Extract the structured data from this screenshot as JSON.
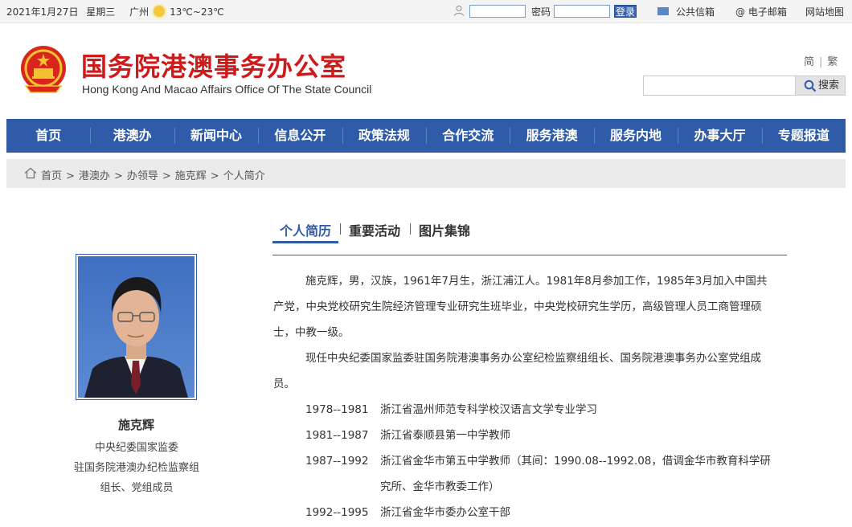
{
  "topbar": {
    "date": "2021年1月27日",
    "weekday": "星期三",
    "city": "广州",
    "temperature": "13℃~23℃",
    "password_label": "密码",
    "login_label": "登录",
    "public_mail": "公共信箱",
    "email": "@ 电子邮箱",
    "sitemap": "网站地图"
  },
  "header": {
    "title": "国务院港澳事务办公室",
    "subtitle": "Hong Kong And Macao Affairs Office Of The State Council",
    "lang_simplified": "简",
    "lang_traditional": "繁",
    "search_placeholder": "",
    "search_label": "搜索"
  },
  "nav": {
    "items": [
      {
        "label": "首页"
      },
      {
        "label": "港澳办"
      },
      {
        "label": "新闻中心"
      },
      {
        "label": "信息公开"
      },
      {
        "label": "政策法规"
      },
      {
        "label": "合作交流"
      },
      {
        "label": "服务港澳"
      },
      {
        "label": "服务内地"
      },
      {
        "label": "办事大厅"
      },
      {
        "label": "专题报道"
      }
    ]
  },
  "breadcrumb": {
    "items": [
      "首页",
      "港澳办",
      "办领导",
      "施克辉",
      "个人简介"
    ],
    "separator": ">"
  },
  "profile": {
    "name": "施克辉",
    "title_line1": "中央纪委国家监委",
    "title_line2": "驻国务院港澳办纪检监察组",
    "title_line3": "组长、党组成员"
  },
  "tabs": {
    "items": [
      {
        "label": "个人简历"
      },
      {
        "label": "重要活动"
      },
      {
        "label": "图片集锦"
      }
    ]
  },
  "bio": {
    "para1": "施克辉，男，汉族，1961年7月生，浙江浦江人。1981年8月参加工作，1985年3月加入中国共产党，中央党校研究生院经济管理专业研究生班毕业，中央党校研究生学历，高级管理人员工商管理硕士，中教一级。",
    "para2": "现任中央纪委国家监委驻国务院港澳事务办公室纪检监察组组长、国务院港澳事务办公室党组成员。",
    "timeline": [
      {
        "years": "1978--1981",
        "desc": "浙江省温州师范专科学校汉语言文学专业学习"
      },
      {
        "years": "1981--1987",
        "desc": "浙江省泰顺县第一中学教师"
      },
      {
        "years": "1987--1992",
        "desc": "浙江省金华市第五中学教师（其间：1990.08--1992.08，借调金华市教育科学研究所、金华市教委工作）"
      },
      {
        "years": "1992--1995",
        "desc": "浙江省金华市委办公室干部"
      }
    ]
  },
  "colors": {
    "brand_blue": "#2f5ba9",
    "title_red": "#cf1a1a"
  }
}
